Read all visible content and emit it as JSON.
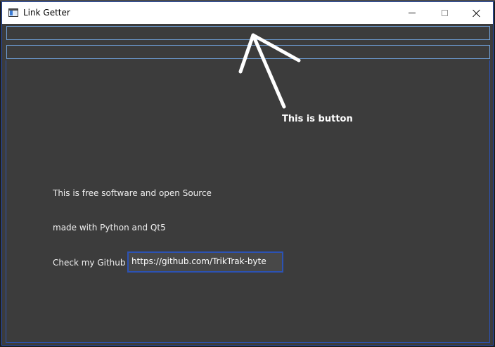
{
  "window": {
    "title": "Link Getter",
    "controls": {
      "minimize": "minimize",
      "maximize": "maximize",
      "close": "close"
    }
  },
  "inputs": [
    {
      "value": "",
      "placeholder": ""
    },
    {
      "value": "",
      "placeholder": ""
    }
  ],
  "about": {
    "line1": "This is free software and open Source",
    "line2": "made with Python and Qt5",
    "github_label": "Check my Github :",
    "github_url": "https://github.com/TrikTrak-byte"
  },
  "annotation": {
    "text": "This is button",
    "color": "#ffffff"
  },
  "colors": {
    "window_bg": "#3c3c3c",
    "accent_border": "#2c52b3",
    "field_border": "#6fa0d8",
    "titlebar_bg": "#ffffff"
  },
  "icons": {
    "app": "app-window-icon",
    "minimize": "minimize-icon",
    "maximize": "maximize-icon",
    "close": "close-icon",
    "annotation_arrow": "arrow-icon"
  }
}
